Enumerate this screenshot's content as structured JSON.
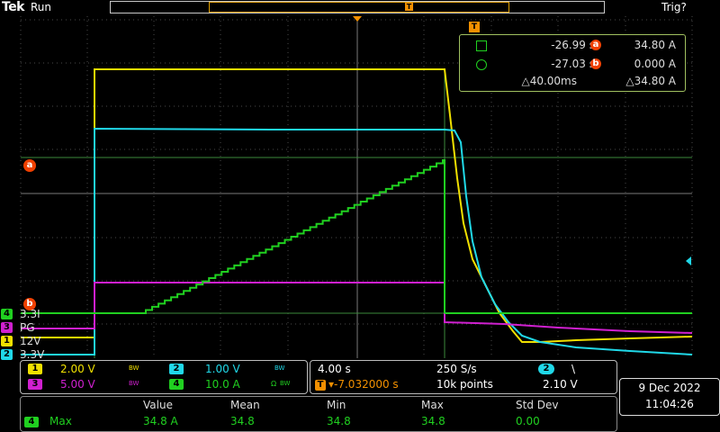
{
  "header": {
    "brand": "Tek",
    "run_state": "Run",
    "trigger_state": "Trig?"
  },
  "colors": {
    "ch1": "#f0e000",
    "ch2": "#20d8e8",
    "ch3": "#d020d0",
    "ch4": "#20d020",
    "cursor": "#f04000",
    "grid": "#4a4a4a",
    "accent": "#f39000"
  },
  "icons": {
    "trigger_marker": "T",
    "trigger_level": "left-arrow"
  },
  "cursors": {
    "a_label": "a",
    "b_label": "b",
    "row1": {
      "time": "-26.99 s",
      "value": "34.80 A"
    },
    "row2": {
      "time": "-27.03 s",
      "value": "0.000 A"
    },
    "delta": {
      "time": "△40.00ms",
      "value": "△34.80 A"
    }
  },
  "channel_labels": [
    {
      "num": "4",
      "text": "3.3I"
    },
    {
      "num": "3",
      "text": "PG"
    },
    {
      "num": "1",
      "text": "12V"
    },
    {
      "num": "2",
      "text": "3.3V"
    }
  ],
  "vertical": {
    "ch1": {
      "num": "1",
      "scale": "2.00 V"
    },
    "ch2": {
      "num": "2",
      "scale": "1.00 V"
    },
    "ch3": {
      "num": "3",
      "scale": "5.00 V"
    },
    "ch4": {
      "num": "4",
      "scale": "10.0 A"
    },
    "bw_label": "BW"
  },
  "horizontal": {
    "scale": "4.00 s",
    "rate": "250 S/s",
    "position": "▾-7.032000 s",
    "record": "10k points",
    "trig_source": "2",
    "trig_slope": "\\",
    "trig_level": "2.10 V"
  },
  "datetime": {
    "date": "9 Dec  2022",
    "time": "11:04:26"
  },
  "measurement": {
    "headers": [
      "Value",
      "Mean",
      "Min",
      "Max",
      "Std Dev"
    ],
    "source": "4",
    "name": "Max",
    "values": [
      "34.8 A",
      "34.8",
      "34.8",
      "34.8",
      "0.00"
    ]
  }
}
